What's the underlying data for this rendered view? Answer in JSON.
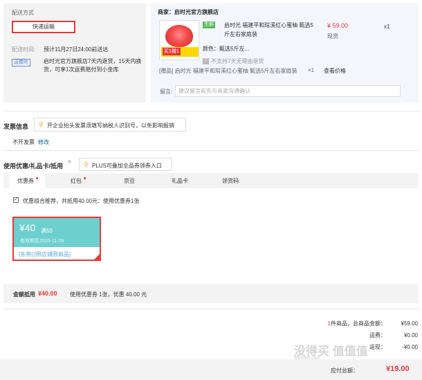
{
  "shipping": {
    "title": "配送方式",
    "method": "快递运输",
    "time_label": "配送时间:",
    "time_value": "预计11月27日24:00前送达",
    "yfx_badge": "运费险",
    "yfx_text": "启时光官方旗舰店7天内退货，15天内换货，可享1次运费赔付到小金库"
  },
  "order": {
    "shop": "商家：启时光官方旗舰店",
    "badge": "生鲜",
    "product_name": "启时光 福建平和琯溪红心蜜柚 甄选5斤左右家庭装",
    "img_tag": "买1赠1",
    "price": "¥ 59.00",
    "stock": "现货",
    "qty": "x1",
    "color": "颜色：甄选5斤左...",
    "noreturn_icon": "7",
    "noreturn": "不支持7天无理由退货",
    "gift": "[赠品]   启时光 福建平和琯溪红心蜜柚 甄选5斤左右家庭装",
    "gift_qty": "×1",
    "gift_link": "查看价格",
    "msg_label": "留言:",
    "msg_placeholder": "建议留言前先与商家沟通确认"
  },
  "invoice": {
    "title": "发票信息",
    "tip": "开企业抬头发票须填写纳税人识别号，以免影响报销",
    "value": "不开发票",
    "edit": "修改"
  },
  "coupons": {
    "title": "使用优惠/礼品卡/抵用",
    "arrow": "^",
    "tip": "PLUS可叠加全品券领券入口",
    "tabs": [
      "优惠券",
      "红包",
      "京豆",
      "礼品卡",
      "领货码"
    ],
    "checkbox_text": "优惠组合推荐，共抵用40.00元：使用优惠券1张",
    "coupon": {
      "amount": "¥40",
      "condition": "满50",
      "expires": "有效期至2020-11-29",
      "tags": "[东券]   [限店铺限商品]"
    },
    "summary_label": "金额抵用",
    "summary_amount": "¥40.00",
    "summary_note": "使用优惠券 1张，优惠 40.00 元"
  },
  "totals": {
    "count": "1",
    "count_label": " 件商品，总商品金额：",
    "goods_amount": "¥59.00",
    "row2_label": "运费：",
    "row2_val": "¥0.00",
    "row3_label": "返现：",
    "row3_val": "-¥0.00",
    "pay_label": "应付总额：",
    "pay_amount": "¥19.00"
  },
  "watermark": {
    "text": "没得买 值值值",
    "url": "Meideb.com"
  },
  "colors": {
    "accent": "#e4393c",
    "coupon": "#6dd0cf",
    "link": "#005ea7"
  }
}
